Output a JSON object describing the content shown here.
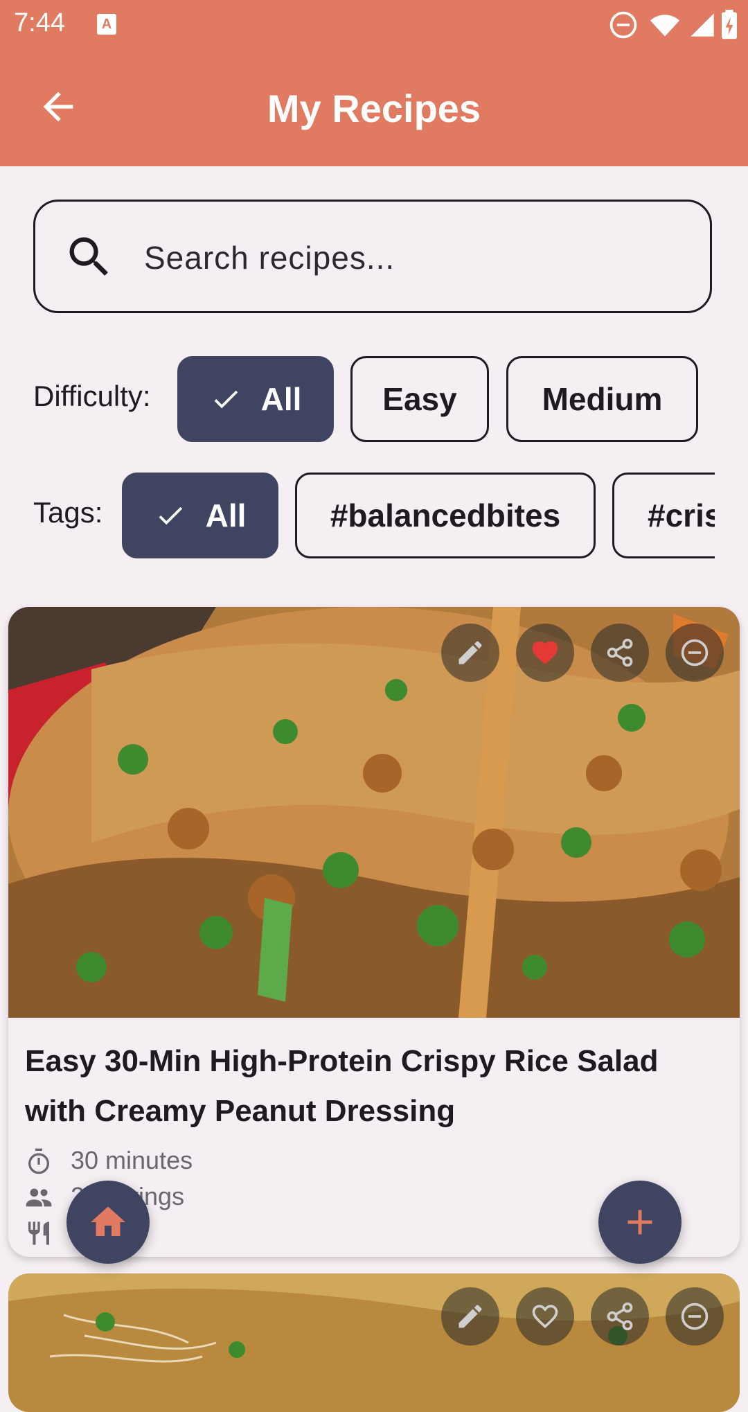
{
  "status_bar": {
    "time": "7:44",
    "icons": [
      "text-notification-icon",
      "do-not-disturb-icon",
      "wifi-icon",
      "signal-icon",
      "battery-charging-icon"
    ]
  },
  "app_bar": {
    "title": "My Recipes",
    "back_icon": "arrow-back-icon"
  },
  "search": {
    "placeholder": "Search recipes...",
    "value": "",
    "icon": "search-icon"
  },
  "difficulty_filter": {
    "label": "Difficulty:",
    "chips": [
      {
        "label": "All",
        "selected": true
      },
      {
        "label": "Easy",
        "selected": false
      },
      {
        "label": "Medium",
        "selected": false
      }
    ]
  },
  "tags_filter": {
    "label": "Tags:",
    "chips": [
      {
        "label": "All",
        "selected": true
      },
      {
        "label": "#balancedbites",
        "selected": false
      },
      {
        "label": "#cris",
        "selected": false
      }
    ]
  },
  "recipes": [
    {
      "title": "Easy 30-Min High-Protein Crispy Rice Salad with Creamy Peanut Dressing",
      "time": "30 minutes",
      "servings": "2 servings",
      "category": "D",
      "favorite": true,
      "actions": [
        "edit-icon",
        "heart-icon",
        "share-icon",
        "remove-icon"
      ]
    },
    {
      "favorite": false,
      "actions": [
        "edit-icon",
        "heart-outline-icon",
        "share-icon",
        "remove-icon"
      ]
    }
  ],
  "fabs": {
    "home_icon": "home-icon",
    "add_icon": "add-icon"
  },
  "colors": {
    "primary": "#e07b62",
    "chip_selected": "#3f4560",
    "background": "#f5eef2",
    "favorite_red": "#e53935",
    "add_fab": "#3f4560",
    "home_fab": "#3f4560",
    "home_icon": "#e07b62"
  }
}
